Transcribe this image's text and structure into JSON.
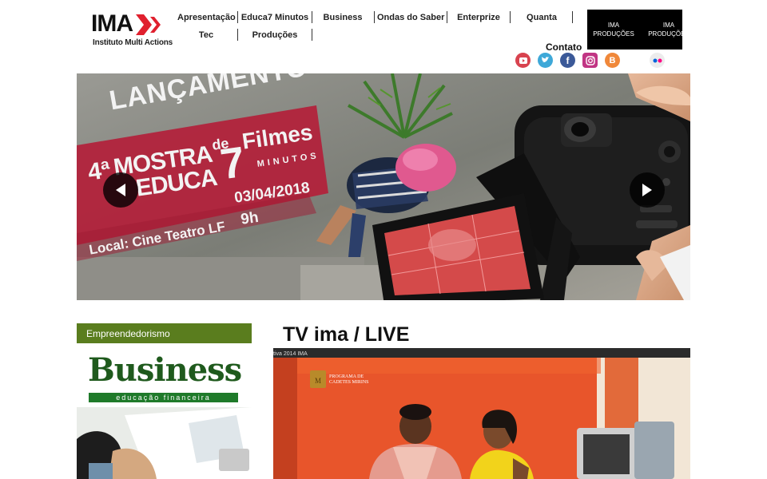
{
  "logo": {
    "name": "IMA",
    "subtitle": "Instituto Multi Actions"
  },
  "nav": {
    "items": [
      "Apresentação",
      "Educa7 Minutos",
      "Business",
      "Ondas do Saber",
      "Enterprize",
      "Quanta",
      "Tec",
      "Produções"
    ],
    "produtoras": [
      "IMA PRODUÇÕES",
      "IMA PRODUÇÕES"
    ]
  },
  "contato": "Contato",
  "social": [
    "youtube-icon",
    "twitter-icon",
    "facebook-icon",
    "instagram-icon",
    "blogger-icon",
    "flickr-icon"
  ],
  "slider": {
    "headline": "LANÇAMENTO",
    "number": "4ª",
    "mostra": "MOSTRA",
    "de": "de",
    "filmes": "Filmes",
    "educa": "EDUCA",
    "seven": "7",
    "minutos": "MINUTOS",
    "date": "03/04/2018",
    "time": "9h",
    "local": "Local: Cine Teatro LF"
  },
  "sidebar": {
    "category": "Empreendedorismo",
    "brand": "Business",
    "tagline": "educação financeira"
  },
  "main": {
    "title": "TV ima / LIVE",
    "video_caption": "tiva 2014 IMA",
    "banner_line1": "PROGRAMA DE",
    "banner_line2": "CADETES MIRINS"
  },
  "colors": {
    "sidebar_header": "#5a7d1e",
    "brand_green": "#1f5a1d",
    "slider_red": "#b3203a",
    "logo_red": "#e0202e"
  }
}
